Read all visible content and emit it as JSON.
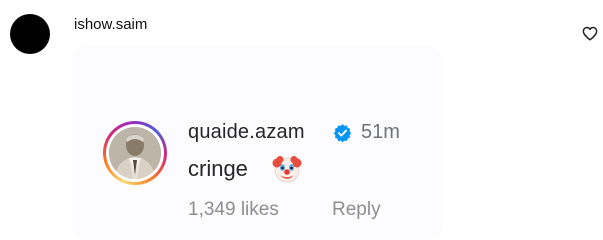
{
  "comment": {
    "username": "ishow.saim",
    "like_icon": "heart-outline-icon"
  },
  "embedded_comment": {
    "username": "quaide.azam",
    "verified_icon": "verified-badge-icon",
    "time_ago": "51m",
    "text": "cringe",
    "emoji_icon": "clown-face-icon",
    "likes": "1,349 likes",
    "reply_label": "Reply"
  },
  "colors": {
    "verified_blue": "#0095f6",
    "muted_text": "#8e8e8e",
    "primary_text": "#262626"
  }
}
